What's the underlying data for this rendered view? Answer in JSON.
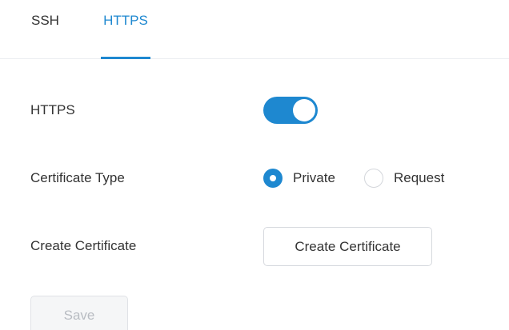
{
  "tabs": [
    {
      "label": "SSH",
      "active": false
    },
    {
      "label": "HTTPS",
      "active": true
    }
  ],
  "form": {
    "https": {
      "label": "HTTPS",
      "enabled": true
    },
    "certificate_type": {
      "label": "Certificate Type",
      "options": [
        {
          "label": "Private",
          "selected": true
        },
        {
          "label": "Request",
          "selected": false
        }
      ]
    },
    "create_certificate": {
      "label": "Create Certificate",
      "button_label": "Create Certificate"
    }
  },
  "actions": {
    "save_label": "Save",
    "save_disabled": true
  },
  "colors": {
    "accent": "#1e88d0",
    "text": "#333333",
    "border": "#d6d9de",
    "disabled_text": "#b8bcc2",
    "disabled_bg": "#f5f6f7"
  }
}
